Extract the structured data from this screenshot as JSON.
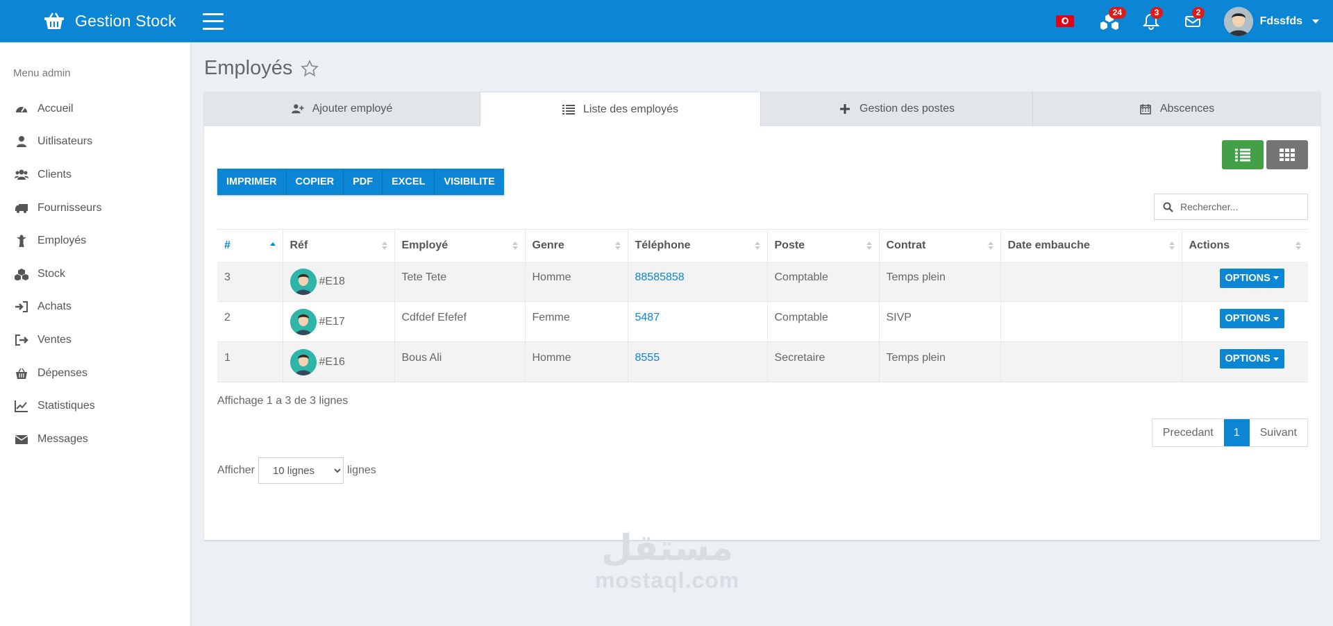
{
  "app": {
    "name": "Gestion Stock"
  },
  "topbar": {
    "notifications": [
      {
        "icon": "cubes-icon",
        "count": "24"
      },
      {
        "icon": "bell-icon",
        "count": "3"
      },
      {
        "icon": "envelope-icon",
        "count": "2"
      }
    ],
    "user_name": "Fdssfds"
  },
  "sidebar": {
    "title": "Menu admin",
    "items": [
      {
        "label": "Accueil",
        "icon": "dashboard-icon"
      },
      {
        "label": "Uitlisateurs",
        "icon": "user-icon"
      },
      {
        "label": "Clients",
        "icon": "users-icon"
      },
      {
        "label": "Fournisseurs",
        "icon": "truck-icon"
      },
      {
        "label": "Employés",
        "icon": "child-icon"
      },
      {
        "label": "Stock",
        "icon": "cubes-icon"
      },
      {
        "label": "Achats",
        "icon": "sign-in-icon"
      },
      {
        "label": "Ventes",
        "icon": "sign-out-icon"
      },
      {
        "label": "Dépenses",
        "icon": "basket-icon"
      },
      {
        "label": "Statistiques",
        "icon": "line-chart-icon"
      },
      {
        "label": "Messages",
        "icon": "envelope-icon"
      }
    ]
  },
  "page": {
    "title": "Employés"
  },
  "tabs": [
    {
      "label": "Ajouter employé",
      "icon": "user-plus-icon"
    },
    {
      "label": "Liste des employés",
      "icon": "list-icon",
      "active": true
    },
    {
      "label": "Gestion des postes",
      "icon": "plus-icon"
    },
    {
      "label": "Abscences",
      "icon": "calendar-icon"
    }
  ],
  "export_buttons": [
    "IMPRIMER",
    "COPIER",
    "PDF",
    "EXCEL",
    "VISIBILITE"
  ],
  "search": {
    "placeholder": "Rechercher..."
  },
  "table": {
    "columns": [
      "#",
      "Réf",
      "Employé",
      "Genre",
      "Téléphone",
      "Poste",
      "Contrat",
      "Date embauche",
      "Actions"
    ],
    "rows": [
      {
        "num": "3",
        "ref": "#E18",
        "employe": "Tete Tete",
        "genre": "Homme",
        "telephone": "88585858",
        "poste": "Comptable",
        "contrat": "Temps plein",
        "date": "",
        "action": "OPTIONS"
      },
      {
        "num": "2",
        "ref": "#E17",
        "employe": "Cdfdef Efefef",
        "genre": "Femme",
        "telephone": "5487",
        "poste": "Comptable",
        "contrat": "SIVP",
        "date": "",
        "action": "OPTIONS"
      },
      {
        "num": "1",
        "ref": "#E16",
        "employe": "Bous Ali",
        "genre": "Homme",
        "telephone": "8555",
        "poste": "Secretaire",
        "contrat": "Temps plein",
        "date": "",
        "action": "OPTIONS"
      }
    ]
  },
  "info": "Affichage 1 a 3 de 3 lignes",
  "pagination": {
    "prev": "Precedant",
    "current": "1",
    "next": "Suivant"
  },
  "length": {
    "prefix": "Afficher",
    "selected": "10 lignes",
    "suffix": "lignes"
  },
  "watermark": {
    "arabic": "مستقل",
    "latin": "mostaql.com"
  },
  "colors": {
    "primary": "#0a86d4",
    "green": "#43a047",
    "gray": "#757575",
    "badge": "#dd1c1a"
  }
}
